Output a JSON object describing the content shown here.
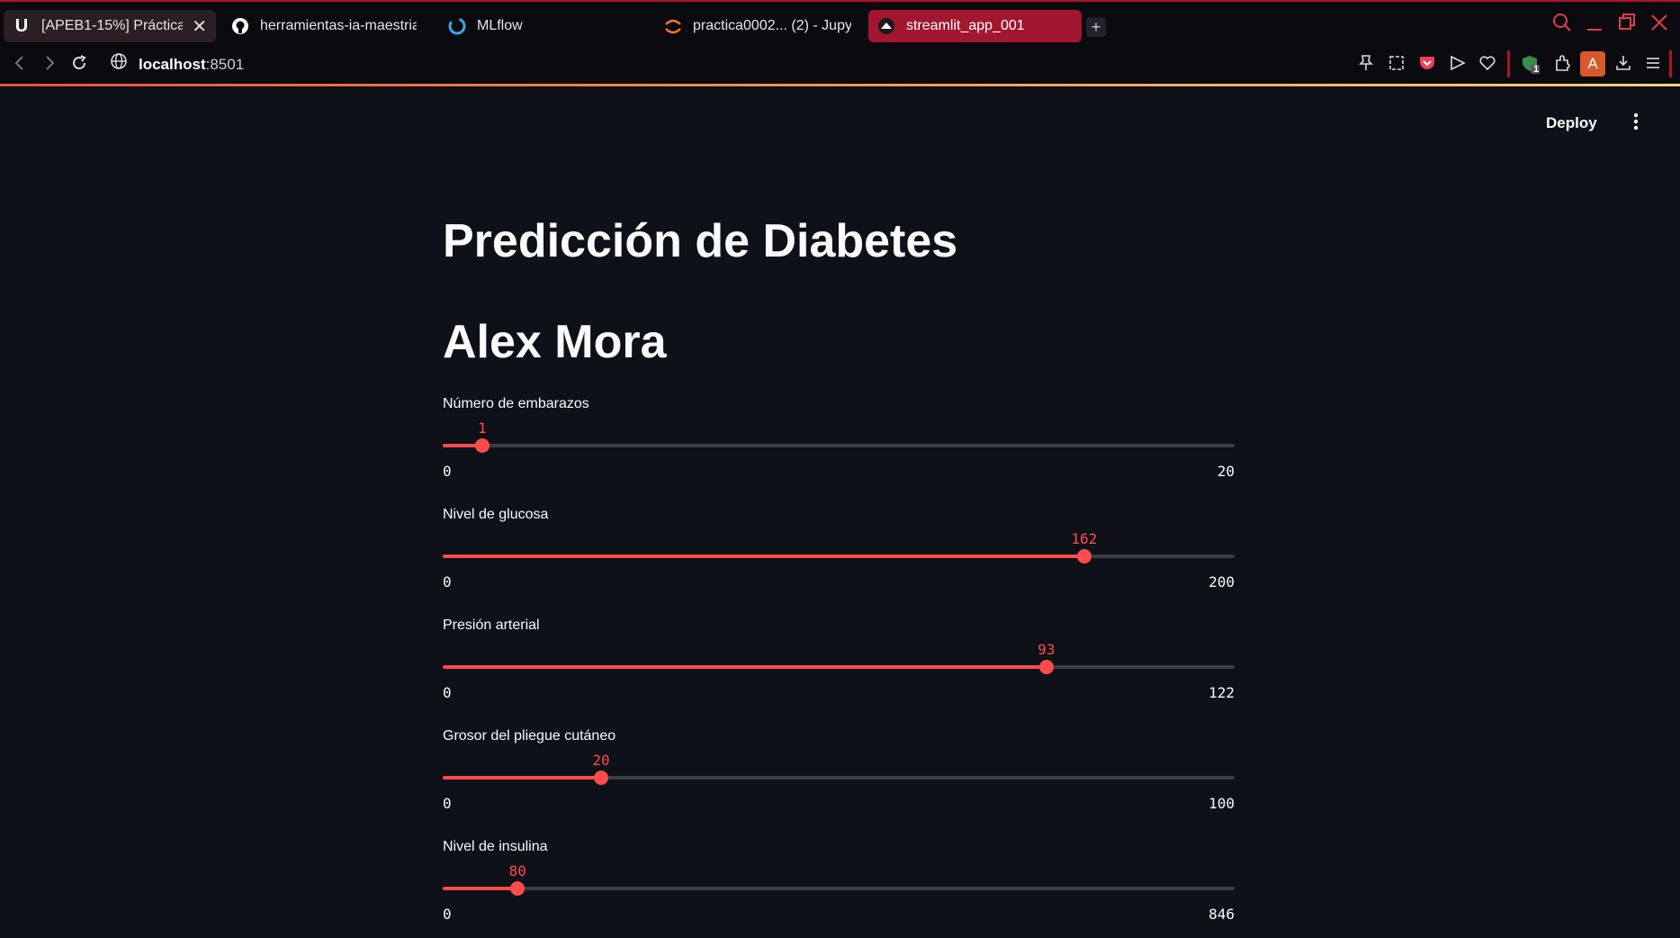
{
  "browser": {
    "tabs": [
      {
        "label": "[APEB1-15%] Práctica",
        "icon": "u-logo-icon",
        "close": "✕"
      },
      {
        "label": "herramientas-ia-maestria",
        "icon": "github-icon"
      },
      {
        "label": "MLflow",
        "icon": "mlflow-icon"
      },
      {
        "label": "practica0002... (2) - Jupy",
        "icon": "jupyter-icon"
      },
      {
        "label": "streamlit_app_001",
        "icon": "streamlit-icon"
      }
    ],
    "new_tab": "+",
    "url_host": "localhost",
    "url_port": ":8501",
    "avatar_letter": "A",
    "badge_count": "1"
  },
  "app": {
    "deploy_label": "Deploy",
    "title": "Predicción de Diabetes",
    "subtitle": "Alex Mora",
    "sliders": [
      {
        "label": "Número de embarazos",
        "value": 1,
        "min": 0,
        "max": 20
      },
      {
        "label": "Nivel de glucosa",
        "value": 162,
        "min": 0,
        "max": 200
      },
      {
        "label": "Presión arterial",
        "value": 93,
        "min": 0,
        "max": 122
      },
      {
        "label": "Grosor del pliegue cutáneo",
        "value": 20,
        "min": 0,
        "max": 100
      },
      {
        "label": "Nivel de insulina",
        "value": 80,
        "min": 0,
        "max": 846
      }
    ]
  },
  "colors": {
    "accent": "#ff4b4b",
    "background": "#0e1117",
    "active_tab": "#a3162f"
  }
}
